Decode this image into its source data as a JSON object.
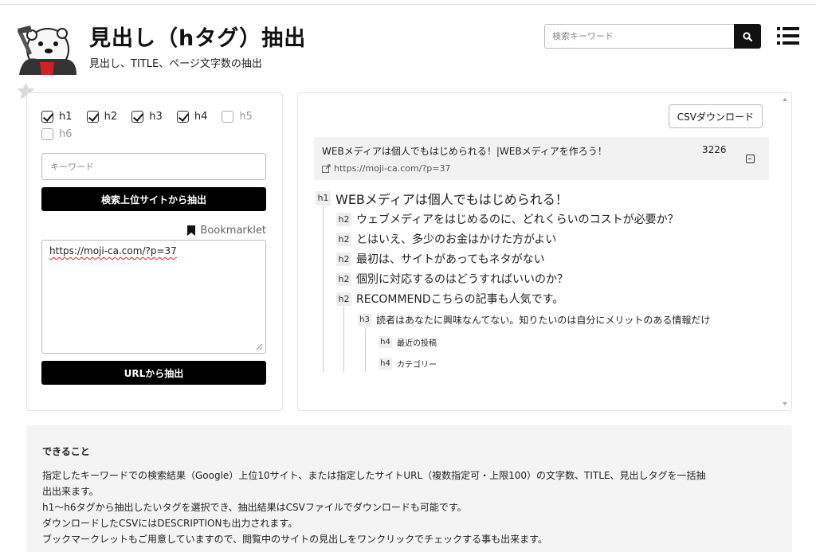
{
  "header": {
    "title": "見出し（hタグ）抽出",
    "subtitle": "見出し、TITLE、ページ文字数の抽出",
    "search_placeholder": "検索キーワード"
  },
  "left_panel": {
    "tags": [
      {
        "label": "h1",
        "checked": true
      },
      {
        "label": "h2",
        "checked": true
      },
      {
        "label": "h3",
        "checked": true
      },
      {
        "label": "h4",
        "checked": true
      },
      {
        "label": "h5",
        "checked": false
      },
      {
        "label": "h6",
        "checked": false
      }
    ],
    "keyword_placeholder": "キーワード",
    "search_extract_button": "検索上位サイトから抽出",
    "bookmarklet_label": "Bookmarklet",
    "url_value": "https://moji-ca.com/?p=37",
    "url_extract_button": "URLから抽出"
  },
  "right_panel": {
    "csv_button": "CSVダウンロード",
    "result": {
      "title": "WEBメディアは個人でもはじめられる！|WEBメディアを作ろう！",
      "char_count": "3226",
      "url": "https://moji-ca.com/?p=37"
    },
    "headings": [
      {
        "tag": "h1",
        "text": "WEBメディアは個人でもはじめられる！"
      },
      {
        "tag": "h2",
        "text": "ウェブメディアをはじめるのに、どれくらいのコストが必要か？"
      },
      {
        "tag": "h2",
        "text": "とはいえ、多少のお金はかけた方がよい"
      },
      {
        "tag": "h2",
        "text": "最初は、サイトがあってもネタがない"
      },
      {
        "tag": "h2",
        "text": "個別に対応するのはどうすればいいのか？"
      },
      {
        "tag": "h2",
        "text": "RECOMMENDこちらの記事も人気です。"
      },
      {
        "tag": "h3",
        "text": "読者はあなたに興味なんてない。知りたいのは自分にメリットのある情報だけ"
      },
      {
        "tag": "h4",
        "text": "最近の投稿"
      },
      {
        "tag": "h4",
        "text": "カテゴリー"
      }
    ]
  },
  "info": {
    "heading": "できること",
    "lines": [
      "指定したキーワードでの検索結果（Google）上位10サイト、または指定したサイトURL（複数指定可・上限100）の文字数、TITLE、見出しタグを一括抽",
      "出出来ます。",
      "h1～h6タグから抽出したいタグを選択でき、抽出結果はCSVファイルでダウンロードも可能です。",
      "ダウンロードしたCSVにはDESCRIPTIONも出力されます。",
      "ブックマークレットもご用意していますので、閲覧中のサイトの見出しをワンクリックでチェックする事も出来ます。"
    ]
  }
}
